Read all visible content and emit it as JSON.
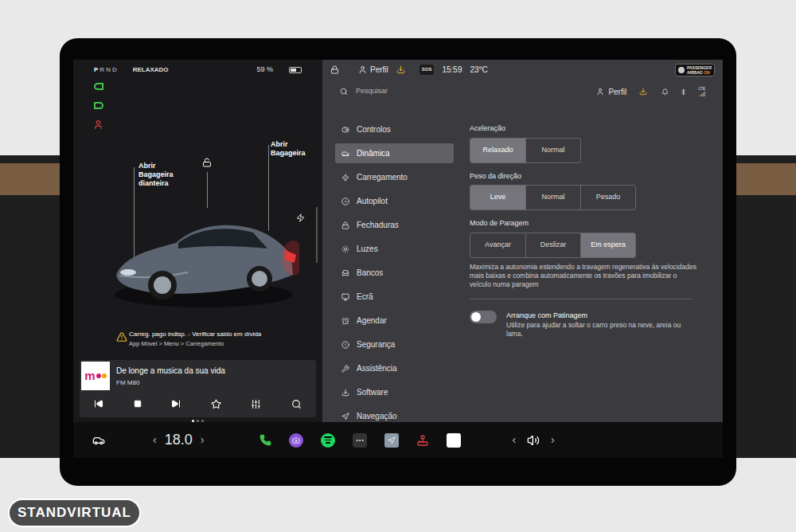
{
  "watermark": "STANDVIRTUAL",
  "status": {
    "gears": [
      {
        "label": "P",
        "selected": true
      },
      {
        "label": "R",
        "selected": false
      },
      {
        "label": "N",
        "selected": false
      },
      {
        "label": "D",
        "selected": false
      }
    ],
    "drive_mode": "RELAXADO",
    "battery": "59 %",
    "battery_level": 0.59
  },
  "car": {
    "front_trunk": [
      "Abrir",
      "Bagageira",
      "dianteira"
    ],
    "rear_trunk": [
      "Abrir",
      "Bagageira"
    ]
  },
  "alert": {
    "title": "Carreg. pago indisp. - Verificar saldo em dívida",
    "subtitle": "App Móvel > Menu > Carregamento"
  },
  "media": {
    "logo": "m",
    "title": "De longe a musica da sua vida",
    "station": "FM M80"
  },
  "pager": [
    {
      "selected": true
    },
    {
      "selected": false
    },
    {
      "selected": false
    }
  ],
  "top_bar": {
    "profile": "Perfil",
    "sos": "SOS",
    "time": "15:59",
    "temperature": "23°C",
    "airbag_top": "PASSENGER",
    "airbag_label": "AIRBAG",
    "airbag_state": "ON"
  },
  "search": {
    "placeholder": "Pesquisar",
    "profile": "Perfil",
    "network": "LTE"
  },
  "menu": [
    {
      "label": "Controlos",
      "selected": false
    },
    {
      "label": "Dinâmica",
      "selected": true
    },
    {
      "label": "Carregamento",
      "selected": false
    },
    {
      "label": "Autopilot",
      "selected": false
    },
    {
      "label": "Fechaduras",
      "selected": false
    },
    {
      "label": "Luzes",
      "selected": false
    },
    {
      "label": "Bancos",
      "selected": false
    },
    {
      "label": "Ecrã",
      "selected": false
    },
    {
      "label": "Agendar",
      "selected": false
    },
    {
      "label": "Segurança",
      "selected": false
    },
    {
      "label": "Assistência",
      "selected": false
    },
    {
      "label": "Software",
      "selected": false
    },
    {
      "label": "Navegação",
      "selected": false
    }
  ],
  "settings": [
    {
      "title": "Aceleração",
      "options": [
        {
          "label": "Relaxado",
          "selected": true
        },
        {
          "label": "Normal",
          "selected": false
        }
      ],
      "description": ""
    },
    {
      "title": "Peso da direção",
      "options": [
        {
          "label": "Leve",
          "selected": true
        },
        {
          "label": "Normal",
          "selected": false
        },
        {
          "label": "Pesado",
          "selected": false
        }
      ],
      "description": ""
    },
    {
      "title": "Modo de Paragem",
      "options": [
        {
          "label": "Avançar",
          "selected": false
        },
        {
          "label": "Deslizar",
          "selected": false
        },
        {
          "label": "Em espera",
          "selected": true
        }
      ],
      "description": "Maximiza a autonomia estendendo a travagem regenerativa às velocidades mais baixas e combina automaticamente os travões para imobilizar o veículo numa paragem"
    }
  ],
  "toggle": {
    "title": "Arranque com Patinagem",
    "description": "Utilize para ajudar a soltar o carro preso na neve, areia ou lama.",
    "on": false
  },
  "bottom_bar": {
    "temp_left": "‹",
    "temperature": "18.0",
    "temp_right": "›",
    "volume_left": "‹",
    "volume_right": "›"
  }
}
